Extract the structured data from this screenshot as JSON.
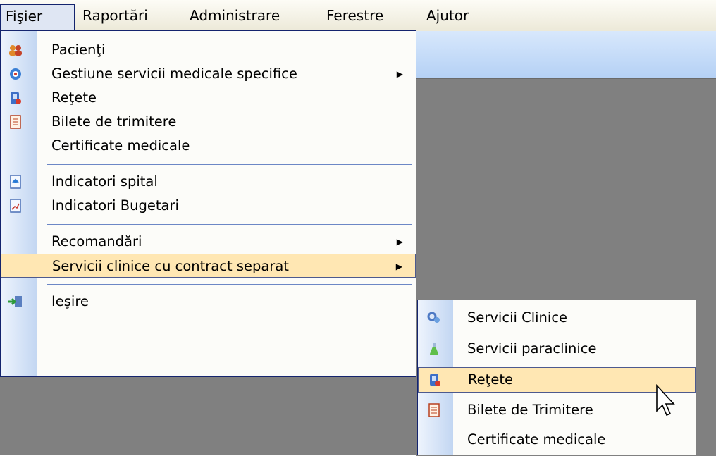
{
  "menubar": {
    "items": [
      "Fişier",
      "Raportări",
      "Administrare",
      "Ferestre",
      "Ajutor"
    ]
  },
  "fisier_menu": {
    "items": [
      {
        "label": "Pacienţi",
        "icon": "patients-icon"
      },
      {
        "label": "Gestiune servicii medicale specifice",
        "icon": "medical-services-icon",
        "submenu": true
      },
      {
        "label": "Reţete",
        "icon": "prescription-icon"
      },
      {
        "label": "Bilete de trimitere",
        "icon": "referral-icon"
      },
      {
        "label": "Certificate medicale",
        "icon": ""
      },
      {
        "label": "Indicatori spital",
        "icon": "hospital-indicators-icon"
      },
      {
        "label": "Indicatori Bugetari",
        "icon": "budget-indicators-icon"
      },
      {
        "label": "Recomandări",
        "icon": "",
        "submenu": true
      },
      {
        "label": "Servicii clinice cu contract separat",
        "icon": "",
        "submenu": true,
        "highlighted": true
      },
      {
        "label": "Ieşire",
        "icon": "exit-icon"
      }
    ]
  },
  "submenu": {
    "items": [
      {
        "label": "Servicii Clinice",
        "icon": "clinical-services-icon"
      },
      {
        "label": "Servicii paraclinice",
        "icon": "paraclinical-flask-icon"
      },
      {
        "label": "Reţete",
        "icon": "prescription-icon",
        "highlighted": true
      },
      {
        "label": "Bilete de Trimitere",
        "icon": "referral-icon"
      },
      {
        "label": "Certificate medicale",
        "icon": ""
      }
    ]
  },
  "colors": {
    "highlight": "#ffe7b3",
    "menu_border": "#14246e",
    "mdi_background": "#808080"
  }
}
